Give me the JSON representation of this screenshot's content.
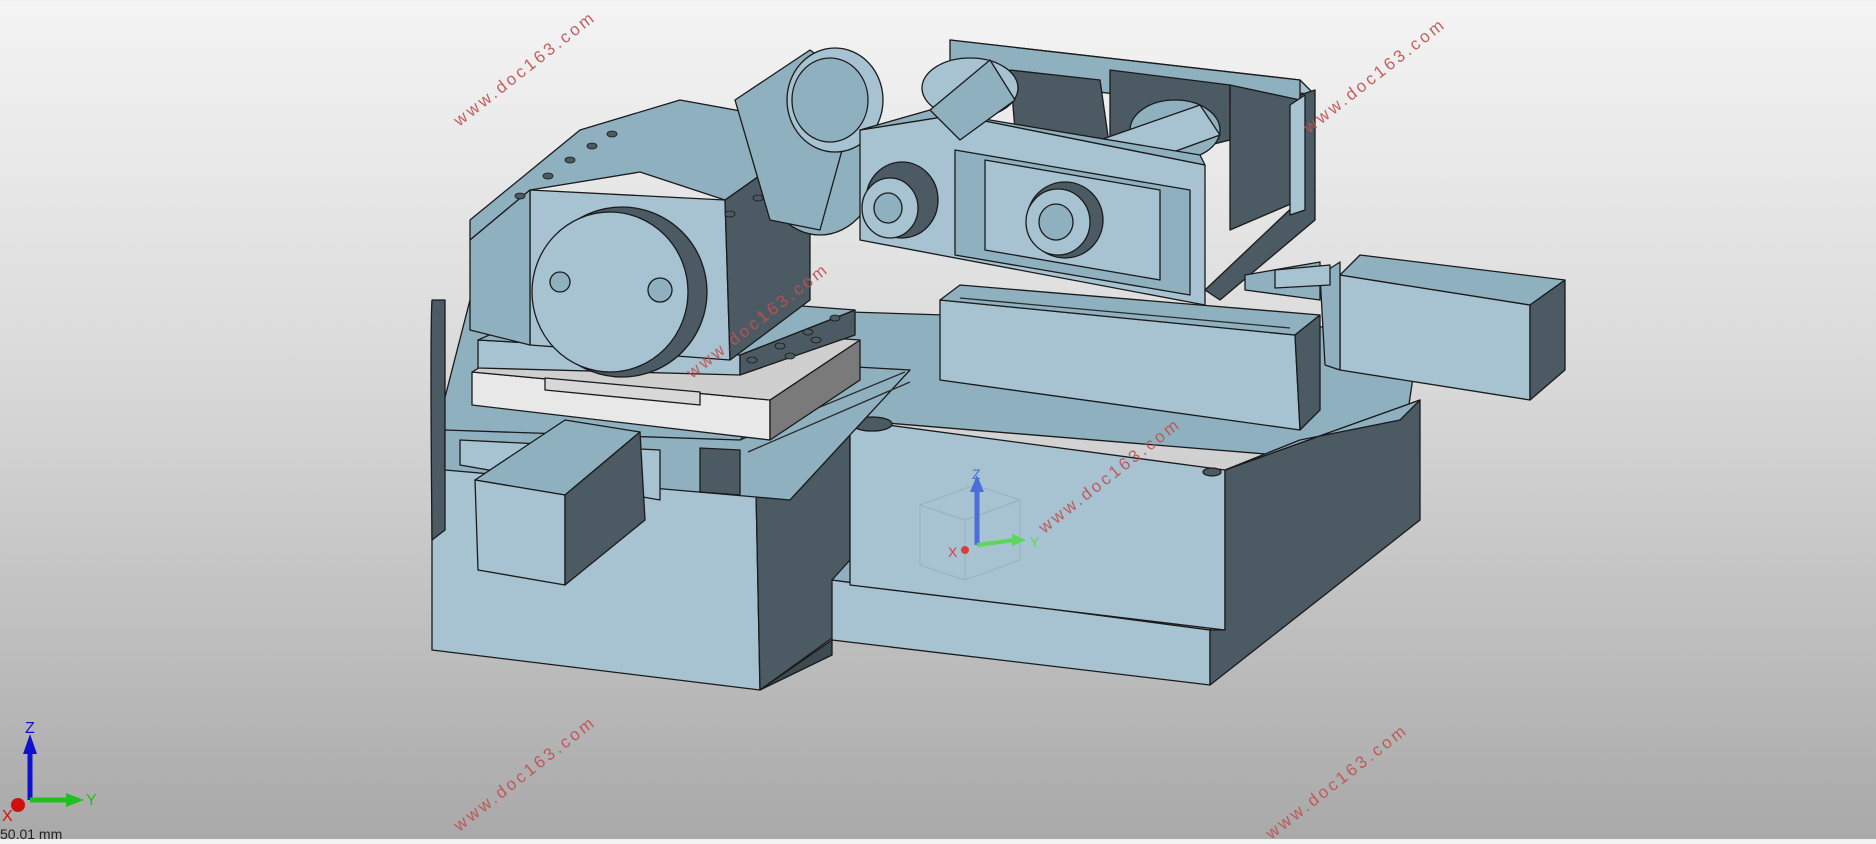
{
  "viewport": {
    "background_top": "#f4f4f4",
    "background_bottom": "#a9a9a9",
    "part_light": "#a7c3d1",
    "part_mid": "#8fb0bf",
    "part_dark": "#4c5b63",
    "edge": "#1a1a1a"
  },
  "watermark": {
    "text": "www.doc163.com",
    "color": "#c05050"
  },
  "triad": {
    "x_label": "X",
    "y_label": "Y",
    "z_label": "Z",
    "x_color": "#d01010",
    "y_color": "#20c020",
    "z_color": "#1010d0"
  },
  "status": {
    "scale_readout": "50.01 mm"
  }
}
